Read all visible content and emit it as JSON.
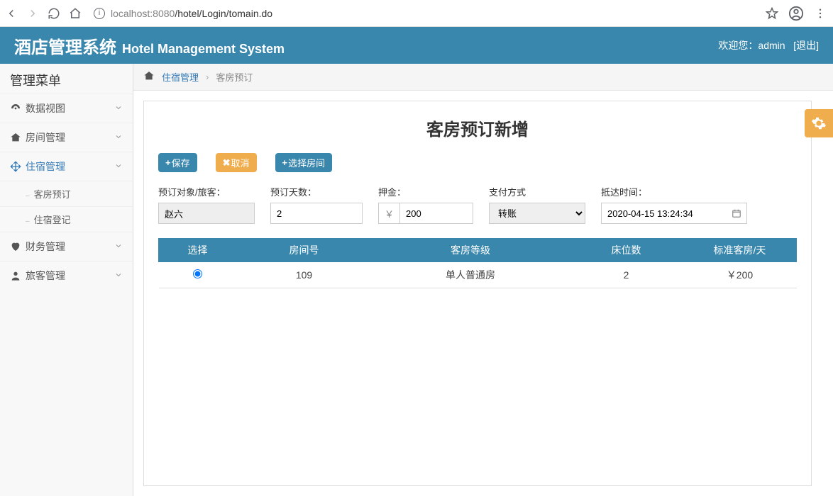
{
  "browser": {
    "url_gray_prefix": "localhost",
    "url_gray_port": ":8080",
    "url_path": "/hotel/Login/tomain.do"
  },
  "header": {
    "logo_cn": "酒店管理系统",
    "logo_en": "Hotel Management System",
    "welcome": "欢迎您：admin",
    "logout": "[退出]"
  },
  "sidebar": {
    "title": "管理菜单",
    "items": [
      {
        "icon": "dashboard-icon",
        "label": "数据视图",
        "active": false
      },
      {
        "icon": "home-icon",
        "label": "房间管理",
        "active": false
      },
      {
        "icon": "move-icon",
        "label": "住宿管理",
        "active": true
      },
      {
        "icon": "heart-icon",
        "label": "财务管理",
        "active": false
      },
      {
        "icon": "user-icon",
        "label": "旅客管理",
        "active": false
      }
    ],
    "sub_items": [
      {
        "label": "客房预订"
      },
      {
        "label": "住宿登记"
      }
    ]
  },
  "breadcrumb": {
    "link": "住宿管理",
    "current": "客房预订"
  },
  "page": {
    "title": "客房预订新增",
    "buttons": {
      "save": "保存",
      "cancel": "取消",
      "choose": "选择房间"
    },
    "form": {
      "guest_label": "预订对象/旅客：",
      "guest_value": "赵六",
      "days_label": "预订天数：",
      "days_value": "2",
      "deposit_label": "押金：",
      "deposit_prefix": "￥",
      "deposit_value": "200",
      "pay_label": "支付方式",
      "pay_value": "转账",
      "arrive_label": "抵达时间：",
      "arrive_value": "2020-04-15 13:24:34"
    },
    "table": {
      "headers": [
        "选择",
        "房间号",
        "客房等级",
        "床位数",
        "标准客房/天"
      ],
      "rows": [
        {
          "room": "109",
          "level": "单人普通房",
          "beds": "2",
          "price": "￥200"
        }
      ]
    }
  }
}
